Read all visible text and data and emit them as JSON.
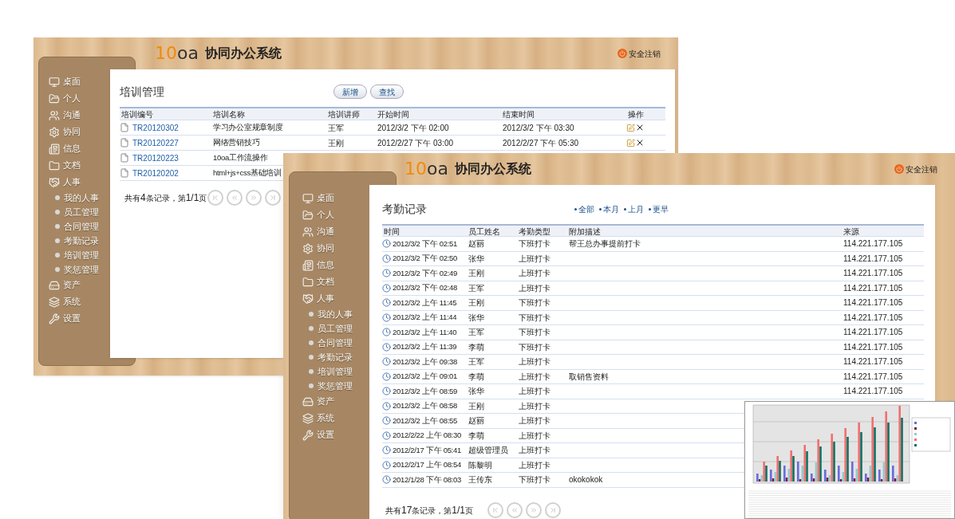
{
  "windows": [
    {
      "logo": {
        "number": "10",
        "letters": "oa"
      },
      "title": "协同办公系统",
      "logout": "安全注销",
      "sidebar": {
        "items": [
          {
            "label": "桌面"
          },
          {
            "label": "个人"
          },
          {
            "label": "沟通"
          },
          {
            "label": "协同"
          },
          {
            "label": "信息"
          },
          {
            "label": "文档"
          },
          {
            "label": "人事",
            "children": [
              {
                "label": "我的人事"
              },
              {
                "label": "员工管理"
              },
              {
                "label": "合同管理"
              },
              {
                "label": "考勤记录"
              },
              {
                "label": "培训管理"
              },
              {
                "label": "奖惩管理"
              }
            ]
          },
          {
            "label": "资产"
          },
          {
            "label": "系统"
          },
          {
            "label": "设置"
          }
        ]
      },
      "page_title": "培训管理",
      "buttons": [
        "新增",
        "查找"
      ],
      "table": {
        "columns": [
          "培训编号",
          "培训名称",
          "培训讲师",
          "开始时间",
          "结束时间",
          "操作"
        ],
        "rows": [
          {
            "id": "TR20120302",
            "name": "学习办公室规章制度",
            "teacher": "王军",
            "start": "2012/3/2 下午 02:00",
            "end": "2012/3/2 下午 03:30",
            "actions": true
          },
          {
            "id": "TR20120227",
            "name": "网络营销技巧",
            "teacher": "王刚",
            "start": "2012/2/27 下午 03:00",
            "end": "2012/2/27 下午 05:30",
            "actions": true
          },
          {
            "id": "TR20120223",
            "name": "10oa工作流操作"
          },
          {
            "id": "TR20120202",
            "name": "html+js+css基础培训"
          }
        ]
      },
      "pagination": "共有**4**条记录，第**1/1**页"
    },
    {
      "logo": {
        "number": "10",
        "letters": "oa"
      },
      "title": "协同办公系统",
      "logout": "安全注销",
      "sidebar": {
        "items": [
          {
            "label": "桌面"
          },
          {
            "label": "个人"
          },
          {
            "label": "沟通"
          },
          {
            "label": "协同"
          },
          {
            "label": "信息"
          },
          {
            "label": "文档"
          },
          {
            "label": "人事",
            "children": [
              {
                "label": "我的人事"
              },
              {
                "label": "员工管理"
              },
              {
                "label": "合同管理"
              },
              {
                "label": "考勤记录"
              },
              {
                "label": "培训管理"
              },
              {
                "label": "奖惩管理"
              }
            ]
          },
          {
            "label": "资产"
          },
          {
            "label": "系统"
          },
          {
            "label": "设置"
          }
        ]
      },
      "page_title": "考勤记录",
      "filters": [
        "全部",
        "本月",
        "上月",
        "更早"
      ],
      "table": {
        "columns": [
          "时间",
          "员工姓名",
          "考勤类型",
          "附加描述",
          "来源"
        ],
        "rows": [
          {
            "time": "2012/3/2 下午 02:51",
            "name": "赵丽",
            "type": "下班打卡",
            "note": "帮王总办事提前打卡",
            "source": "114.221.177.105"
          },
          {
            "time": "2012/3/2 下午 02:50",
            "name": "张华",
            "type": "上班打卡",
            "source": "114.221.177.105"
          },
          {
            "time": "2012/3/2 下午 02:49",
            "name": "王刚",
            "type": "上班打卡",
            "source": "114.221.177.105"
          },
          {
            "time": "2012/3/2 下午 02:48",
            "name": "王军",
            "type": "上班打卡",
            "source": "114.221.177.105"
          },
          {
            "time": "2012/3/2 上午 11:45",
            "name": "王刚",
            "type": "下班打卡",
            "source": "114.221.177.105"
          },
          {
            "time": "2012/3/2 上午 11:44",
            "name": "张华",
            "type": "下班打卡",
            "source": "114.221.177.105"
          },
          {
            "time": "2012/3/2 上午 11:40",
            "name": "王军",
            "type": "下班打卡",
            "source": "114.221.177.105"
          },
          {
            "time": "2012/3/2 上午 11:39",
            "name": "李萌",
            "type": "下班打卡",
            "source": "114.221.177.105"
          },
          {
            "time": "2012/3/2 上午 09:38",
            "name": "王军",
            "type": "上班打卡",
            "source": "114.221.177.105"
          },
          {
            "time": "2012/3/2 上午 09:01",
            "name": "李萌",
            "type": "上班打卡",
            "note": "取销售资料",
            "source": "114.221.177.105"
          },
          {
            "time": "2012/3/2 上午 08:59",
            "name": "张华",
            "type": "上班打卡",
            "source": "114.221.177.105"
          },
          {
            "time": "2012/3/2 上午 08:58",
            "name": "王刚",
            "type": "上班打卡"
          },
          {
            "time": "2012/3/2 上午 08:55",
            "name": "赵丽",
            "type": "上班打卡"
          },
          {
            "time": "2012/2/22 上午 08:30",
            "name": "李萌",
            "type": "上班打卡"
          },
          {
            "time": "2012/2/17 下午 05:41",
            "name": "超级管理员",
            "type": "上班打卡"
          },
          {
            "time": "2012/2/17 上午 08:54",
            "name": "陈黎明",
            "type": "上班打卡"
          },
          {
            "time": "2012/1/28 下午 08:03",
            "name": "王传东",
            "type": "下班打卡",
            "note": "okokokok"
          }
        ]
      },
      "pagination": "共有**17**条记录，第**1/1**页"
    }
  ]
}
